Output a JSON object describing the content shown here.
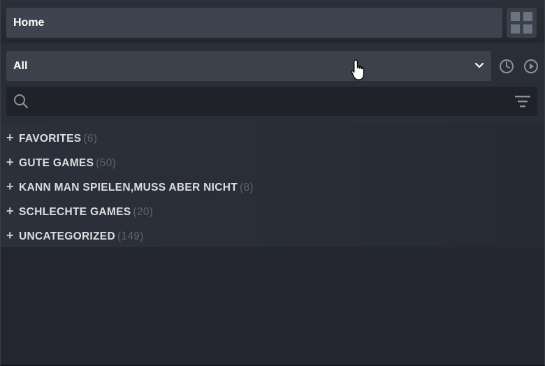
{
  "header": {
    "home_label": "Home",
    "view_toggle_icon": "grid-icon"
  },
  "filter": {
    "selected": "All",
    "recent_icon": "clock-icon",
    "playing_icon": "play-circle-icon"
  },
  "search": {
    "value": "",
    "placeholder": ""
  },
  "categories": [
    {
      "label": "FAVORITES",
      "count": "(6)"
    },
    {
      "label": "GUTE GAMES",
      "count": "(50)"
    },
    {
      "label": "KANN MAN SPIELEN,MUSS ABER NICHT",
      "count": "(8)"
    },
    {
      "label": "SCHLECHTE GAMES",
      "count": "(20)"
    },
    {
      "label": "UNCATEGORIZED",
      "count": "(149)"
    }
  ],
  "colors": {
    "background": "#23262e",
    "button": "#3d4450",
    "text": "#dcdedf",
    "count": "#5e646d"
  }
}
